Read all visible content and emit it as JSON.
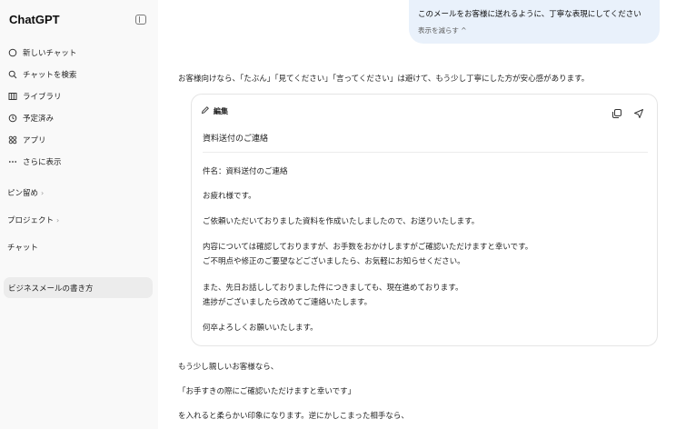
{
  "app": {
    "title": "ChatGPT"
  },
  "sidebar": {
    "nav": [
      {
        "label": "新しいチャット",
        "icon": "new-chat-icon"
      },
      {
        "label": "チャットを検索",
        "icon": "search-icon"
      },
      {
        "label": "ライブラリ",
        "icon": "library-icon"
      },
      {
        "label": "予定済み",
        "icon": "clock-icon"
      },
      {
        "label": "アプリ",
        "icon": "apps-icon"
      },
      {
        "label": "さらに表示",
        "icon": "more-icon"
      }
    ],
    "sections": {
      "pinned": "ピン留め",
      "projects": "プロジェクト",
      "chats": "チャット"
    },
    "chats": [
      {
        "label": "ビジネスメールの書き方"
      }
    ]
  },
  "conversation": {
    "user_message": "このメールをお客様に送れるように、丁寧な表現にしてください",
    "show_less": "表示を減らす ^",
    "intro": "お客様向けなら、「たぶん」「見てください」「言ってください」は避けて、もう少し丁寧にした方が安心感があります。",
    "card": {
      "edit_label": "編集",
      "title": "資料送付のご連絡",
      "lines": [
        "件名：資料送付のご連絡",
        "お疲れ様です。",
        "ご依頼いただいておりました資料を作成いたしましたので、お送りいたします。",
        "内容については確認しておりますが、お手数をおかけしますがご確認いただけますと幸いです。",
        "ご不明点や修正のご要望などございましたら、お気軽にお知らせください。",
        "また、先日お話ししておりました件につきましても、現在進めております。",
        "進捗がございましたら改めてご連絡いたします。",
        "何卒よろしくお願いいたします。"
      ]
    },
    "after": [
      "もう少し親しいお客様なら、",
      "「お手すきの際にご確認いただけますと幸いです」",
      "を入れると柔らかい印象になります。逆にかしこまった相手なら、"
    ]
  }
}
